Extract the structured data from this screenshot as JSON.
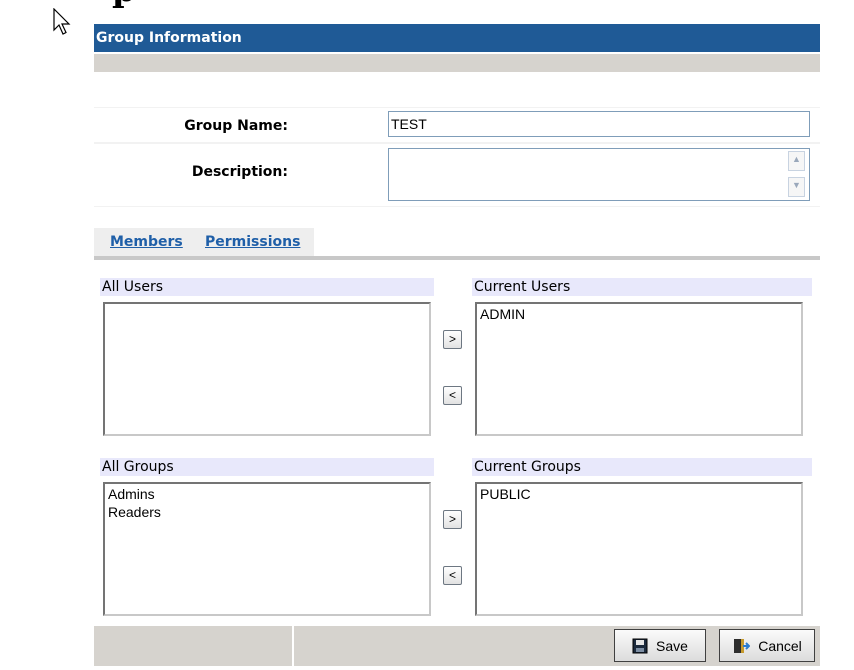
{
  "page": {
    "heading_fragment": "p"
  },
  "header": {
    "title": "Group Information"
  },
  "form": {
    "group_name_label": "Group Name:",
    "group_name_value": "TEST",
    "description_label": "Description:",
    "description_value": ""
  },
  "tabs": [
    {
      "label": "Members"
    },
    {
      "label": "Permissions"
    }
  ],
  "users": {
    "all_label": "All Users",
    "all_items": [],
    "current_label": "Current Users",
    "current_items": [
      "ADMIN"
    ]
  },
  "groups": {
    "all_label": "All Groups",
    "all_items": [
      "Admins",
      "Readers"
    ],
    "current_label": "Current Groups",
    "current_items": [
      "PUBLIC"
    ]
  },
  "move_buttons": {
    "add": ">",
    "remove": "<"
  },
  "footer": {
    "save_label": "Save",
    "cancel_label": "Cancel"
  },
  "colors": {
    "title_bar": "#1f5a96",
    "link": "#1f5fa8",
    "list_header": "#e8e8fb",
    "panel_grey": "#d6d3ce"
  }
}
